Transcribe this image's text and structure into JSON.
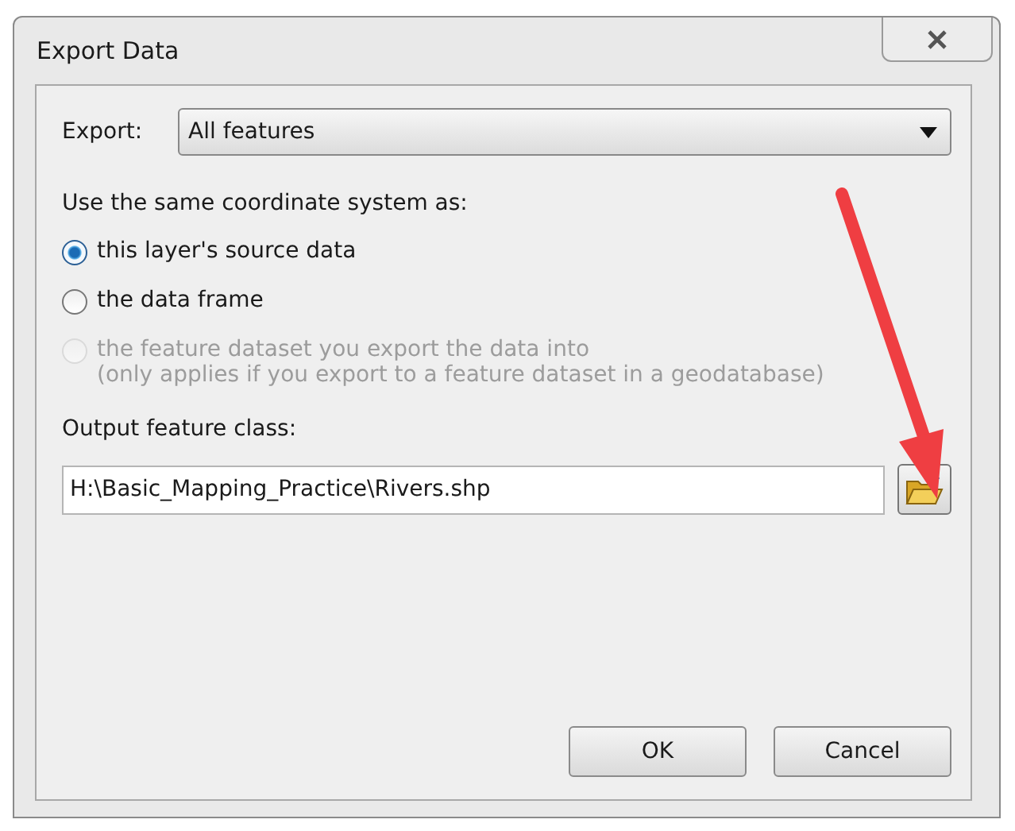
{
  "window": {
    "title": "Export Data"
  },
  "export": {
    "label": "Export:",
    "value": "All features"
  },
  "coordinate_heading": "Use the same coordinate system as:",
  "options": [
    {
      "label": "this layer's source data",
      "selected": true,
      "disabled": false
    },
    {
      "label": "the data frame",
      "selected": false,
      "disabled": false
    },
    {
      "label": "the feature dataset you export the data into",
      "note": "(only applies if you export to a feature dataset in a geodatabase)",
      "selected": false,
      "disabled": true
    }
  ],
  "output": {
    "label": "Output feature class:",
    "value": "H:\\Basic_Mapping_Practice\\Rivers.shp"
  },
  "buttons": [
    "OK",
    "Cancel"
  ]
}
